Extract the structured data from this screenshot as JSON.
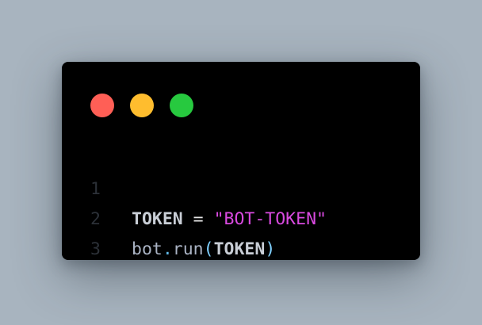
{
  "window": {
    "controls": [
      {
        "name": "close",
        "color": "#ff5f56"
      },
      {
        "name": "minimize",
        "color": "#ffbd2e"
      },
      {
        "name": "maximize",
        "color": "#27c93f"
      }
    ]
  },
  "code": {
    "lines": [
      {
        "number": "1",
        "tokens": [
          {
            "text": "TOKEN",
            "kind": "var"
          },
          {
            "text": " = ",
            "kind": "op"
          },
          {
            "text": "\"BOT-TOKEN\"",
            "kind": "str"
          }
        ]
      },
      {
        "number": "2",
        "tokens": [
          {
            "text": "bot",
            "kind": "ident"
          },
          {
            "text": ".",
            "kind": "dot"
          },
          {
            "text": "run",
            "kind": "ident"
          },
          {
            "text": "(",
            "kind": "paren"
          },
          {
            "text": "TOKEN",
            "kind": "var"
          },
          {
            "text": ")",
            "kind": "paren"
          }
        ]
      },
      {
        "number": "3",
        "tokens": []
      }
    ]
  }
}
